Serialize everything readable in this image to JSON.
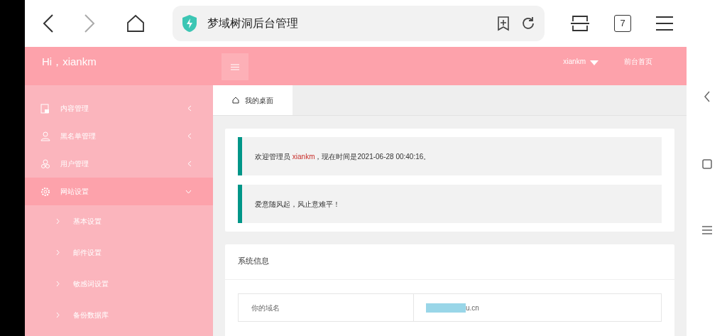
{
  "browser": {
    "address_title": "梦域树洞后台管理",
    "tab_count": "7"
  },
  "header": {
    "greeting": "Hi，xiankm",
    "user": "xiankm",
    "front_link": "前台首页"
  },
  "sidebar": {
    "items": [
      {
        "label": "内容管理",
        "expanded": false,
        "selected": false
      },
      {
        "label": "黑名单管理",
        "expanded": false,
        "selected": false
      },
      {
        "label": "用户管理",
        "expanded": false,
        "selected": false
      },
      {
        "label": "网站设置",
        "expanded": true,
        "selected": true,
        "children": [
          {
            "label": "基本设置"
          },
          {
            "label": "邮件设置"
          },
          {
            "label": "敏感词设置"
          },
          {
            "label": "备份数据库"
          }
        ]
      }
    ]
  },
  "tabs": [
    {
      "label": "我的桌面",
      "selected": true
    }
  ],
  "notices": [
    {
      "before": "欢迎管理员 ",
      "user": "xiankm",
      "after": "，现在时间是2021-06-28 00:40:16。"
    },
    {
      "before": "爱意随风起，风止意难平！"
    }
  ],
  "system_info": {
    "title": "系统信息",
    "rows": [
      {
        "label": "你的域名",
        "value": "u.cn",
        "redacted": true
      }
    ]
  }
}
